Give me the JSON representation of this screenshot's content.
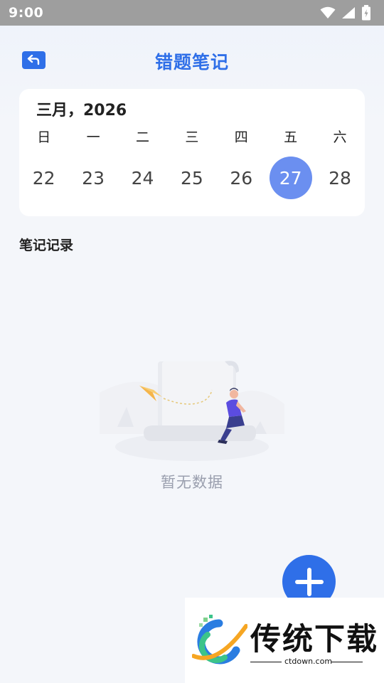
{
  "status_bar": {
    "time": "9:00"
  },
  "header": {
    "title": "错题笔记"
  },
  "calendar": {
    "month_label": "三月，2026",
    "weekdays": [
      "日",
      "一",
      "二",
      "三",
      "四",
      "五",
      "六"
    ],
    "dates": [
      "22",
      "23",
      "24",
      "25",
      "26",
      "27",
      "28"
    ],
    "selected_date": "27",
    "accent_color": "#6b8ff0"
  },
  "notes": {
    "section_title": "笔记记录",
    "empty_text": "暂无数据"
  },
  "fab": {
    "icon": "plus-icon"
  },
  "watermark": {
    "text": "传统下载",
    "url": "ctdown.com"
  },
  "colors": {
    "brand": "#2f6fe8",
    "background": "#f4f6fa"
  }
}
